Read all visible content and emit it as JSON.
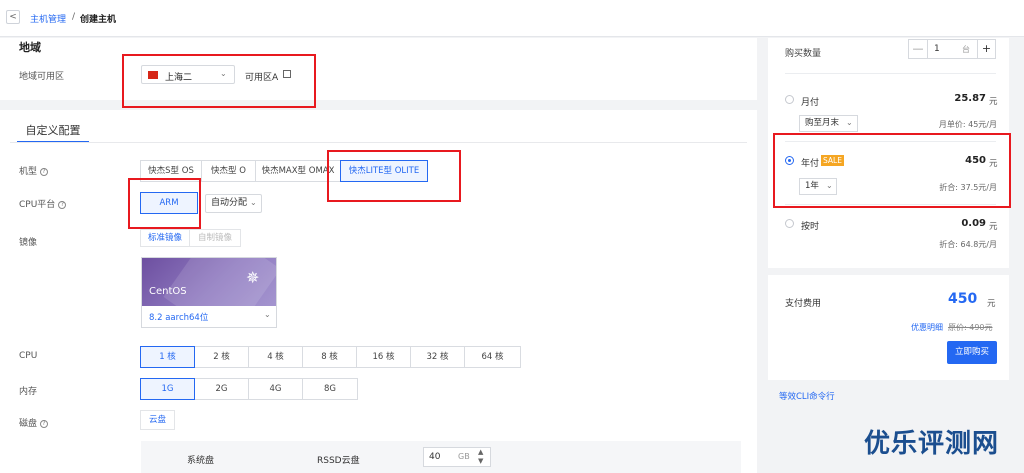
{
  "breadcrumb": {
    "back": "<",
    "parent": "主机管理",
    "separator": "/",
    "current": "创建主机"
  },
  "region": {
    "title": "地域",
    "label": "地域可用区",
    "selected_region": "上海二",
    "zone": "可用区A"
  },
  "custom": {
    "tab_label": "自定义配置",
    "model": {
      "label": "机型",
      "options": [
        "快杰S型 OS",
        "快杰型 O",
        "快杰MAX型 OMAX",
        "快杰LITE型 OLITE"
      ],
      "selected": "快杰LITE型 OLITE"
    },
    "cpu_platform": {
      "label": "CPU平台",
      "selected": "ARM",
      "allocation": "自动分配"
    },
    "image": {
      "label": "镜像",
      "tabs": [
        "标准镜像",
        "自制镜像"
      ],
      "os_name": "CentOS",
      "os_version": "8.2 aarch64位"
    },
    "cpu": {
      "label": "CPU",
      "options": [
        "1 核",
        "2 核",
        "4 核",
        "8 核",
        "16 核",
        "32 核",
        "64 核"
      ],
      "selected": "1 核"
    },
    "memory": {
      "label": "内存",
      "options": [
        "1G",
        "2G",
        "4G",
        "8G"
      ],
      "selected": "1G"
    },
    "disk": {
      "label": "磁盘",
      "type": "云盘",
      "system_disk_label": "系统盘",
      "system_disk_type": "RSSD云盘",
      "size": "40",
      "unit": "GB"
    }
  },
  "purchase": {
    "quantity_label": "购买数量",
    "quantity": "1",
    "quantity_unit": "台",
    "minus": "—",
    "plus": "+",
    "monthly": {
      "label": "月付",
      "price": "25.87",
      "unit": "元",
      "period": "购至月末",
      "unit_price": "月单价: 45元/月"
    },
    "yearly": {
      "label": "年付",
      "badge": "SALE",
      "price": "450",
      "unit": "元",
      "period": "1年",
      "equiv": "折合: 37.5元/月"
    },
    "hourly": {
      "label": "按时",
      "price": "0.09",
      "unit": "元",
      "equiv": "折合: 64.8元/月"
    },
    "selected_billing": "年付",
    "total_label": "支付费用",
    "total": "450",
    "total_unit": "元",
    "discount_link": "优惠明细",
    "original_price": "原价: 490元",
    "buy_button": "立即购买",
    "cli_link": "等效CLI命令行"
  },
  "watermark": "优乐评测网",
  "colors": {
    "accent": "#2468f2",
    "highlight_box": "#e8191f",
    "sale_badge": "#f5a623"
  }
}
